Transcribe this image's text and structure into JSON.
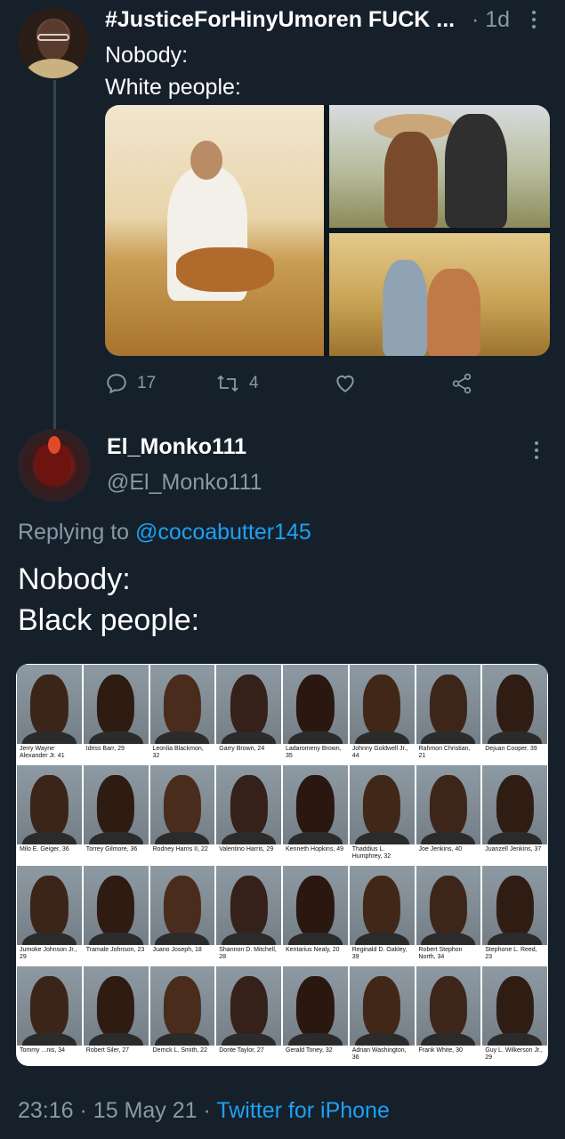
{
  "parent": {
    "name": "#JusticeForHinyUmoren FUCK ...",
    "time_sep": "·",
    "time": "1d",
    "lines": [
      "Nobody:",
      "White people:"
    ],
    "stats": {
      "replies": "17",
      "retweets": "4",
      "likes": ""
    }
  },
  "reply": {
    "name": "El_Monko111",
    "handle": "@El_Monko111",
    "replying_prefix": "Replying to",
    "replying_to": "@cocoabutter145",
    "lines": [
      "Nobody:",
      "Black people:"
    ],
    "mugshots": [
      "Jerry Wayne Alexander Jr. 41",
      "Idriss Barr, 29",
      "Leonlia Blackmon, 32",
      "Garry Brown, 24",
      "Ladaromeny Brown, 35",
      "Johnny Goldwell Jr., 44",
      "Rahmon Christian, 21",
      "Dejuan Cooper, 39",
      "Milo E. Geiger, 36",
      "Torrey Gilmore, 36",
      "Rodney Harris II, 22",
      "Valentino Harris, 29",
      "Kenneth Hopkins, 49",
      "Thaddius L. Humphrey, 32",
      "Joe Jenkins, 40",
      "Juanzell Jenkins, 37",
      "Jumoke Johnson Jr., 29",
      "Tramale Johnson, 23",
      "Juano Joseph, 18",
      "Shannon D. Mitchell, 28",
      "Kentarius Nealy, 20",
      "Reginald D. Oakley, 39",
      "Robert Stephon North, 34",
      "Stephone L. Reed, 23",
      "Tommy ...nis, 34",
      "Robert Siler, 27",
      "Derrick L. Smith, 22",
      "Donte Taylor, 27",
      "Gerald Toney, 32",
      "Adrian Washington, 36",
      "Frank White, 30",
      "Guy L. Wilkerson Jr., 29"
    ],
    "footer": {
      "time": "23:16",
      "sep1": "·",
      "date": "15 May 21",
      "sep2": "·",
      "source": "Twitter for iPhone"
    }
  },
  "colors": {
    "background": "#15202b",
    "muted": "#8899a6",
    "link": "#1da1f2",
    "thread_line": "#38444d"
  }
}
